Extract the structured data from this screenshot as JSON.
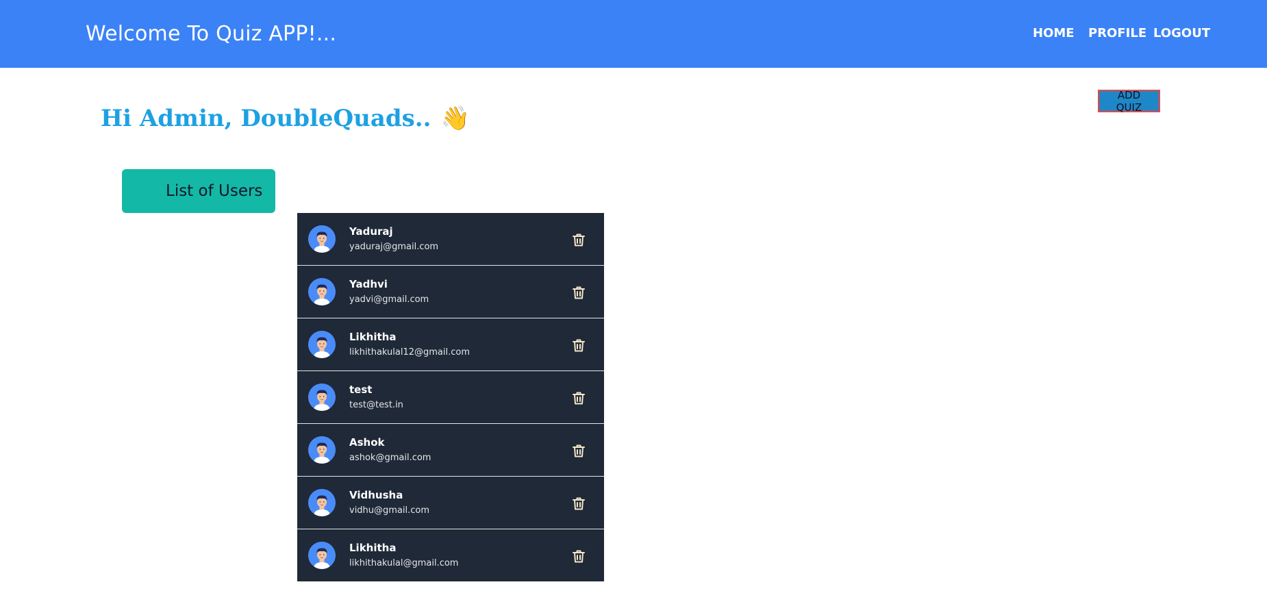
{
  "navbar": {
    "brand": "Welcome To Quiz APP!...",
    "links": [
      "HOME",
      "PROFILE",
      "LOGOUT"
    ]
  },
  "greeting": {
    "text": "Hi Admin, DoubleQuads..",
    "emoji": "👋"
  },
  "add_quiz_label": "ADD QUIZ",
  "users_header": "List of Users",
  "users": [
    {
      "name": "Yaduraj",
      "email": "yaduraj@gmail.com"
    },
    {
      "name": "Yadhvi",
      "email": "yadvi@gmail.com"
    },
    {
      "name": "Likhitha",
      "email": "likhithakulal12@gmail.com"
    },
    {
      "name": "test",
      "email": "test@test.in"
    },
    {
      "name": "Ashok",
      "email": "ashok@gmail.com"
    },
    {
      "name": "Vidhusha",
      "email": "vidhu@gmail.com"
    },
    {
      "name": "Likhitha",
      "email": "likhithakulal@gmail.com"
    }
  ],
  "icons": {
    "avatar": "avatar-icon",
    "delete": "trash-icon",
    "wave": "waving-hand-icon"
  },
  "colors": {
    "navbar": "#3b82f6",
    "greeting": "#1da1e3",
    "users_header": "#14b8a6",
    "user_row": "#1f2937",
    "trash_icon": "#f5e6c8",
    "add_quiz_bg": "#1e87c8",
    "add_quiz_border": "#ef4444"
  }
}
